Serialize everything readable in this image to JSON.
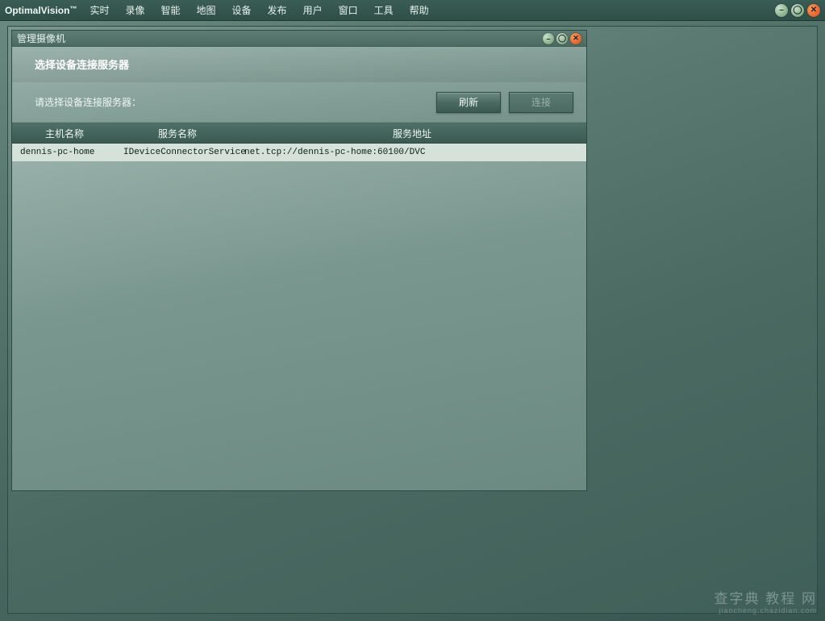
{
  "app": {
    "title": "OptimalVision",
    "tm": "™"
  },
  "menu": {
    "items": [
      "实时",
      "录像",
      "智能",
      "地图",
      "设备",
      "发布",
      "用户",
      "窗口",
      "工具",
      "帮助"
    ]
  },
  "dialog": {
    "title": "管理摄像机",
    "heading": "选择设备连接服务器",
    "prompt": "请选择设备连接服务器：",
    "buttons": {
      "refresh": "刷新",
      "connect": "连接"
    },
    "columns": {
      "host": "主机名称",
      "service": "服务名称",
      "address": "服务地址"
    },
    "rows": [
      {
        "host": "dennis-pc-home",
        "service": "IDeviceConnectorService",
        "address": "net.tcp://dennis-pc-home:60100/DVC"
      }
    ]
  },
  "watermark": {
    "line1": "查字典 教程 网",
    "line2": "jiaocheng.chazidian.com"
  }
}
